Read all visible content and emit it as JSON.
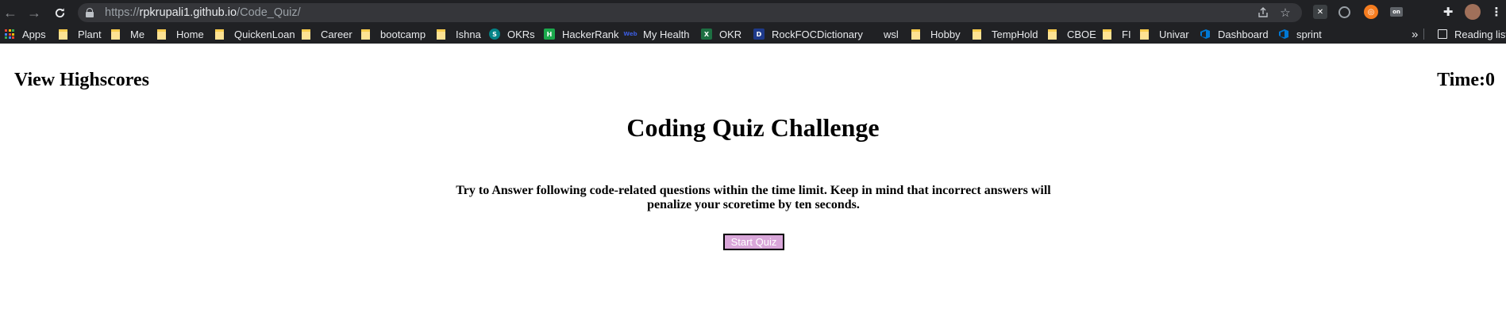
{
  "browser": {
    "url_scheme": "https://",
    "url_host": "rpkrupali1.github.io",
    "url_path": "/Code_Quiz/",
    "bookmarks": {
      "apps": "Apps",
      "plant": "Plant",
      "me": "Me",
      "home": "Home",
      "quickenloan": "QuickenLoan",
      "career": "Career",
      "bootcamp": "bootcamp",
      "ishna": "Ishna",
      "okrs": "OKRs",
      "hackerrank": "HackerRank",
      "myhealth": "My Health",
      "okr": "OKR",
      "rockfoc": "RockFOCDictionary",
      "wsl": "wsl",
      "hobby": "Hobby",
      "temphold": "TempHold",
      "cboe": "CBOE",
      "fi": "FI",
      "univar": "Univar",
      "dashboard": "Dashboard",
      "sprint": "sprint",
      "overflow": "»",
      "reading_list": "Reading list"
    },
    "favicon_text": {
      "okrs": "S",
      "hackerrank": "H",
      "myhealth": "Web",
      "okr": "X",
      "rockfoc": "D"
    }
  },
  "header": {
    "view_highscores": "View Highscores",
    "timer": "Time:0"
  },
  "main": {
    "title": "Coding Quiz Challenge",
    "description": "Try to Answer following code-related questions within the time limit. Keep in mind that incorrect answers will penalize your scoretime by ten seconds.",
    "start_button": "Start Quiz"
  },
  "colors": {
    "chrome_bg": "#202124",
    "omnibox_bg": "#35363a",
    "start_button_bg": "#d9a6d9",
    "folder": "#fde293"
  }
}
